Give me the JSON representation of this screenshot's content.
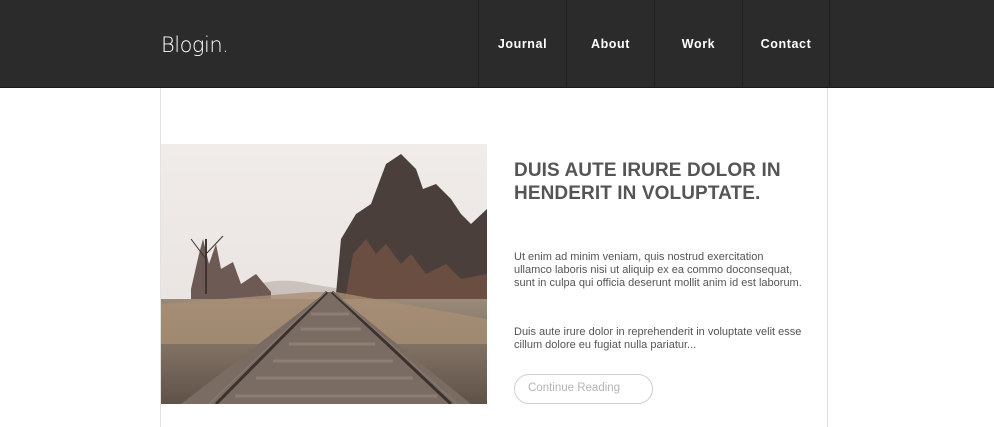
{
  "header": {
    "logo_text": "Blogin.",
    "nav": [
      {
        "label": "Journal"
      },
      {
        "label": "About"
      },
      {
        "label": "Work"
      },
      {
        "label": "Contact"
      }
    ]
  },
  "post": {
    "title": "DUIS AUTE IRURE DOLOR IN HENDERIT IN VOLUPTATE.",
    "paragraph_1": "Ut enim ad minim veniam, quis nostrud exercitation ullamco laboris nisi ut aliquip ex ea commo doconsequat, sunt in culpa qui officia deserunt mollit anim id est laborum.",
    "paragraph_2": "Duis aute irure dolor in reprehenderit in voluptate velit esse cillum dolore eu fugiat nulla pariatur...",
    "read_more_label": "Continue Reading"
  },
  "colors": {
    "header_bg": "#2b2b2b",
    "text": "#555555",
    "button_border": "#cfcfcf"
  }
}
